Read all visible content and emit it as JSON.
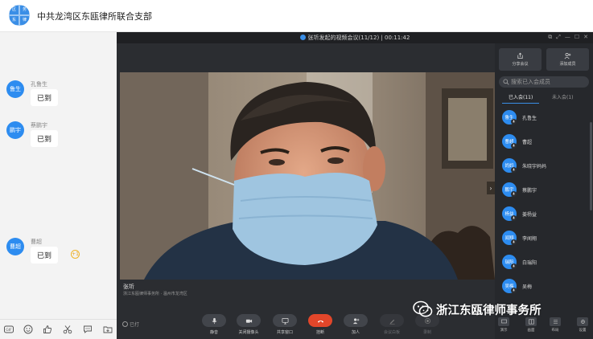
{
  "header": {
    "title": "中共龙湾区东瓯律所联合支部",
    "group_avatar_chars": [
      "区",
      "务",
      "东",
      "律"
    ]
  },
  "chat": {
    "messages": [
      {
        "avatar": "鲁生",
        "name": "孔鲁生",
        "text": "已到"
      },
      {
        "avatar": "鹏宇",
        "name": "蔡鹏宇",
        "text": "已到"
      },
      {
        "avatar": "曹超",
        "name": "曹超",
        "text": "已到",
        "badge": "+1"
      }
    ],
    "toolbar_icons": [
      "gif-icon",
      "emoji-icon",
      "thumbs-up-icon",
      "scissors-icon",
      "chat-bubble-icon",
      "folder-icon"
    ]
  },
  "meeting": {
    "title": "张圻发起的视频会议(11/12) | 00:11:42",
    "speaker": {
      "name": "张圻",
      "subtitle": "浙江东瓯律师事务所 · 温州市龙湾区"
    },
    "mic_status": "已打",
    "controls": [
      {
        "id": "mute",
        "label": "静音",
        "icon": "mic-icon",
        "state": "normal"
      },
      {
        "id": "camera",
        "label": "关闭摄像头",
        "icon": "camera-icon",
        "state": "normal"
      },
      {
        "id": "share",
        "label": "共享窗口",
        "icon": "screen-share-icon",
        "state": "normal"
      },
      {
        "id": "hangup",
        "label": "挂断",
        "icon": "hangup-icon",
        "state": "danger"
      },
      {
        "id": "add",
        "label": "加人",
        "icon": "add-person-icon",
        "state": "normal"
      },
      {
        "id": "whiteboard",
        "label": "会议白板",
        "icon": "whiteboard-icon",
        "state": "disabled"
      },
      {
        "id": "record",
        "label": "录制",
        "icon": "record-icon",
        "state": "disabled"
      }
    ]
  },
  "participants": {
    "actions": [
      {
        "label": "分享会议",
        "icon": "share-icon"
      },
      {
        "label": "添加成员",
        "icon": "add-member-icon"
      }
    ],
    "search_placeholder": "搜索已入会成员",
    "tabs": [
      {
        "label": "已入会(11)",
        "active": true
      },
      {
        "label": "未入会(1)",
        "active": false
      }
    ],
    "list": [
      {
        "avatar": "鲁生",
        "name": "孔鲁生"
      },
      {
        "avatar": "曹超",
        "name": "曹超"
      },
      {
        "avatar": "妈妈",
        "name": "朱晓宇妈妈"
      },
      {
        "avatar": "鹏宇",
        "name": "蔡鹏宇"
      },
      {
        "avatar": "杨益",
        "name": "姜杨益"
      },
      {
        "avatar": "闻翔",
        "name": "李闻翔"
      },
      {
        "avatar": "瑞阳",
        "name": "白瑞阳"
      },
      {
        "avatar": "吴梅",
        "name": "吴梅"
      }
    ],
    "bottom_controls": [
      {
        "label": "演示",
        "icon": "present-icon"
      },
      {
        "label": "画面",
        "icon": "layout-icon"
      },
      {
        "label": "布局",
        "icon": "grid-icon"
      },
      {
        "label": "设置",
        "icon": "settings-icon"
      }
    ]
  },
  "watermark": {
    "text": "浙江东瓯律师事务所",
    "icon": "wechat-icon"
  },
  "colors": {
    "accent": "#2d8cf0",
    "hangup": "#e2462a",
    "meeting_bg": "#2b2d31"
  }
}
